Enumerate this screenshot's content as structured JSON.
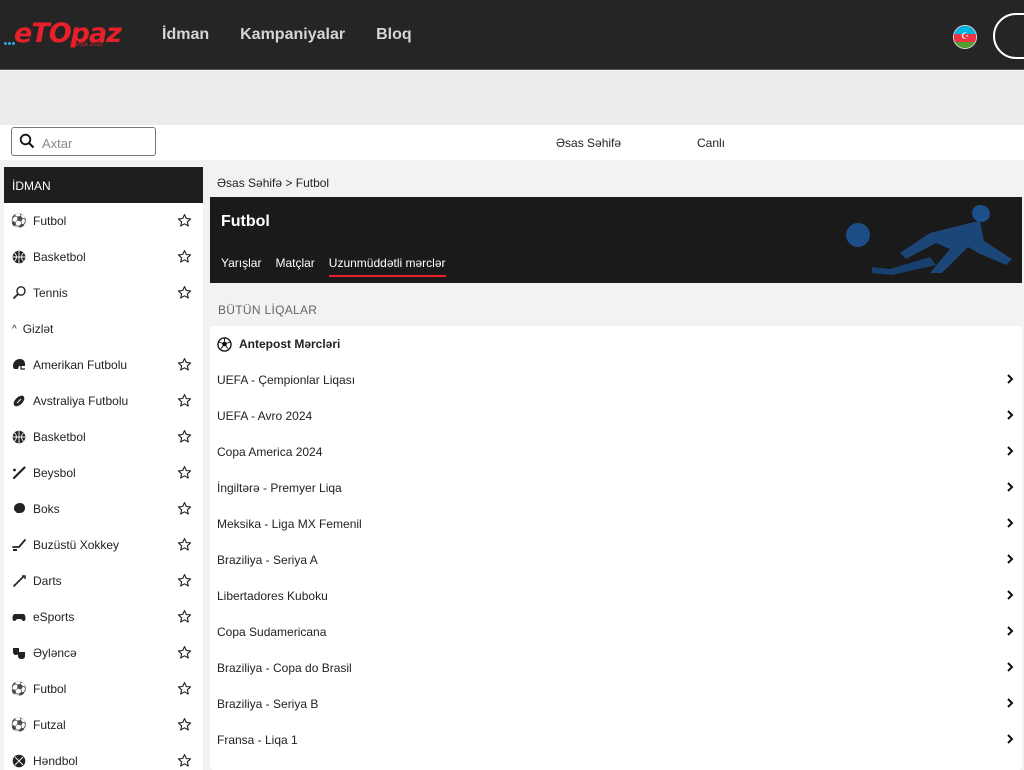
{
  "header": {
    "logo_text": "eTOpaz",
    "logo_tagline": "since 2012",
    "nav": [
      "İdman",
      "Kampaniyalar",
      "Bloq"
    ]
  },
  "subbar": {
    "search_placeholder": "Axtar",
    "links": [
      "Əsas Səhifə",
      "Canlı"
    ]
  },
  "sidebar": {
    "title": "İDMAN",
    "favorites": [
      {
        "label": "Futbol",
        "icon": "soccer-ball-icon"
      },
      {
        "label": "Basketbol",
        "icon": "basketball-icon"
      },
      {
        "label": "Tennis",
        "icon": "tennis-racket-icon"
      }
    ],
    "toggle_label": "Gizlət",
    "items": [
      {
        "label": "Amerikan Futbolu",
        "icon": "football-helmet-icon"
      },
      {
        "label": "Avstraliya Futbolu",
        "icon": "rugby-ball-icon"
      },
      {
        "label": "Basketbol",
        "icon": "basketball-icon"
      },
      {
        "label": "Beysbol",
        "icon": "baseball-bat-icon"
      },
      {
        "label": "Boks",
        "icon": "boxing-glove-icon"
      },
      {
        "label": "Buzüstü Xokkey",
        "icon": "hockey-stick-icon"
      },
      {
        "label": "Darts",
        "icon": "dart-icon"
      },
      {
        "label": "eSports",
        "icon": "gamepad-icon"
      },
      {
        "label": "Əyləncə",
        "icon": "theater-masks-icon"
      },
      {
        "label": "Futbol",
        "icon": "soccer-ball-icon"
      },
      {
        "label": "Futzal",
        "icon": "soccer-ball-icon"
      },
      {
        "label": "Həndbol",
        "icon": "handball-icon"
      }
    ]
  },
  "breadcrumb": "Əsas Səhifə > Futbol",
  "hero": {
    "title": "Futbol",
    "tabs": [
      "Yarışlar",
      "Matçlar",
      "Uzunmüddətli mərclər"
    ],
    "active_tab": "Uzunmüddətli mərclər"
  },
  "section_title": "BÜTÜN LİQALAR",
  "panel": {
    "heading": "Antepost Mərcləri",
    "rows": [
      "UEFA - Çempionlar Liqası",
      "UEFA - Avro 2024",
      "Copa America 2024",
      "İngiltərə - Premyer Liqa",
      "Meksika - Liga MX Femenil",
      "Braziliya - Seriya A",
      "Libertadores Kuboku",
      "Copa Sudamericana",
      "Braziliya - Copa do Brasil",
      "Braziliya - Seriya B",
      "Fransa - Liqa 1"
    ]
  },
  "colors": {
    "accent": "#e8202a",
    "topbar": "#252525",
    "hero": "#1a1a1a"
  }
}
